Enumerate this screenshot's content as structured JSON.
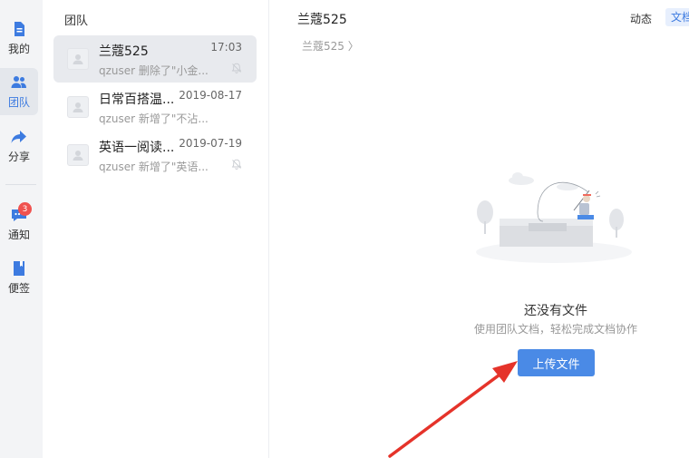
{
  "nav": {
    "items": [
      {
        "label": "我的",
        "icon": "file-icon"
      },
      {
        "label": "团队",
        "icon": "team-icon"
      },
      {
        "label": "分享",
        "icon": "share-arrow-icon"
      },
      {
        "label": "通知",
        "icon": "message-icon",
        "badge": "3"
      },
      {
        "label": "便签",
        "icon": "note-icon"
      }
    ],
    "active": "团队"
  },
  "list": {
    "title": "团队",
    "items": [
      {
        "name": "兰蔻525",
        "time": "17:03",
        "desc": "qzuser 删除了\"小金...",
        "muted": true
      },
      {
        "name": "日常百搭温...",
        "time": "2019-08-17",
        "desc": "qzuser 新增了\"不沾...",
        "muted": false
      },
      {
        "name": "英语一阅读...",
        "time": "2019-07-19",
        "desc": "qzuser 新增了\"英语...",
        "muted": true
      }
    ]
  },
  "main": {
    "title": "兰蔻525",
    "tabs": [
      "动态",
      "文档"
    ],
    "breadcrumb": "兰蔻525 〉",
    "empty_title": "还没有文件",
    "empty_subtitle": "使用团队文档，轻松完成文档协作",
    "upload_label": "上传文件"
  },
  "colors": {
    "accent": "#4a8ae6",
    "badge": "#f0524f",
    "arrow": "#e5332a"
  }
}
